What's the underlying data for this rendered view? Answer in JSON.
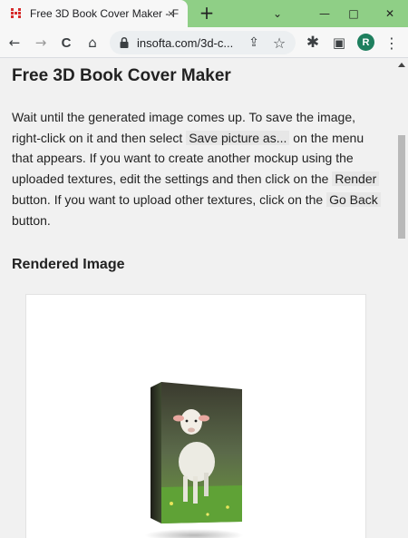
{
  "browser": {
    "tab": {
      "title": "Free 3D Book Cover Maker - F",
      "close_glyph": "×"
    },
    "new_tab_glyph": "+",
    "window": {
      "chevron": "⌄",
      "minimize": "—",
      "maximize": "□",
      "close": "✕"
    },
    "toolbar": {
      "back": "←",
      "forward": "→",
      "reload": "C",
      "home": "⌂",
      "url": "insofta.com/3d-c...",
      "share": "⇪",
      "bookmark": "☆",
      "extensions": "✱",
      "sidepanel": "▣",
      "profile_initial": "R",
      "menu": "⋮"
    }
  },
  "page": {
    "title": "Free 3D Book Cover Maker",
    "intro": {
      "p1": "Wait until the generated image comes up. To save the image, right-click on it and then select ",
      "code1": "Save picture as...",
      "p2": " on the menu that appears. If you want to create another mockup using the uploaded textures, edit the settings and then click on the ",
      "code2": "Render",
      "p3": " button. If you want to upload other textures, click on the ",
      "code3": "Go Back",
      "p4": " button."
    },
    "section_title": "Rendered Image"
  },
  "colors": {
    "tabstrip": "#8fcf86",
    "toolbar": "#f7f7f7",
    "page_bg": "#f1f1f1",
    "avatar": "#1e7f5e",
    "favicon": "#d62b2b"
  },
  "icons": [
    "app-favicon-icon",
    "lock-icon",
    "share-icon",
    "star-icon",
    "puzzle-icon",
    "sidepanel-icon",
    "kebab-menu-icon"
  ]
}
